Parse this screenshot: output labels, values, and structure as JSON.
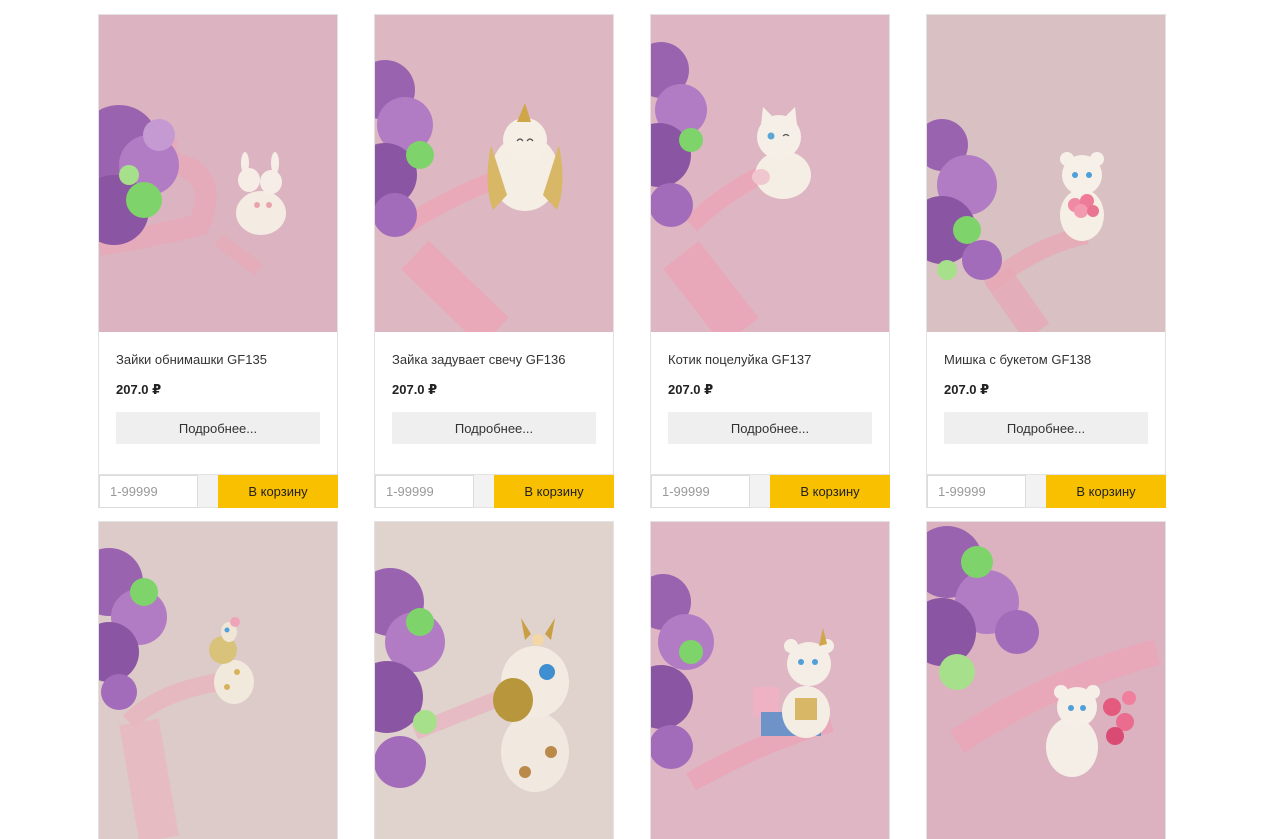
{
  "products": [
    {
      "title": "Зайки обнимашки GF135",
      "price": "207.0 ₽",
      "more_label": "Подробнее...",
      "qty_placeholder": "1-99999",
      "cart_label": "В корзину",
      "figurine": "bunnies-hugging",
      "bg": "#dcb3c0"
    },
    {
      "title": "Зайка задувает свечу GF136",
      "price": "207.0 ₽",
      "more_label": "Подробнее...",
      "qty_placeholder": "1-99999",
      "cart_label": "В корзину",
      "figurine": "bunny-unicorn",
      "bg": "#ddb8c3"
    },
    {
      "title": "Котик поцелуйка GF137",
      "price": "207.0 ₽",
      "more_label": "Подробнее...",
      "qty_placeholder": "1-99999",
      "cart_label": "В корзину",
      "figurine": "kitten-kiss",
      "bg": "#deb5c2"
    },
    {
      "title": "Мишка с букетом GF138",
      "price": "207.0 ₽",
      "more_label": "Подробнее...",
      "qty_placeholder": "1-99999",
      "cart_label": "В корзину",
      "figurine": "bear-bouquet",
      "bg": "#d8c0c3"
    },
    {
      "title": "",
      "price": "",
      "more_label": "",
      "qty_placeholder": "",
      "cart_label": "",
      "figurine": "giraffe-small",
      "bg": "#dccbc8"
    },
    {
      "title": "",
      "price": "",
      "more_label": "",
      "qty_placeholder": "",
      "cart_label": "",
      "figurine": "giraffe-large",
      "bg": "#e0d2cc"
    },
    {
      "title": "",
      "price": "",
      "more_label": "",
      "qty_placeholder": "",
      "cart_label": "",
      "figurine": "bear-gift",
      "bg": "#dfb6c3"
    },
    {
      "title": "",
      "price": "",
      "more_label": "",
      "qty_placeholder": "",
      "cart_label": "",
      "figurine": "bear-hearts",
      "bg": "#dcb2c0"
    }
  ]
}
